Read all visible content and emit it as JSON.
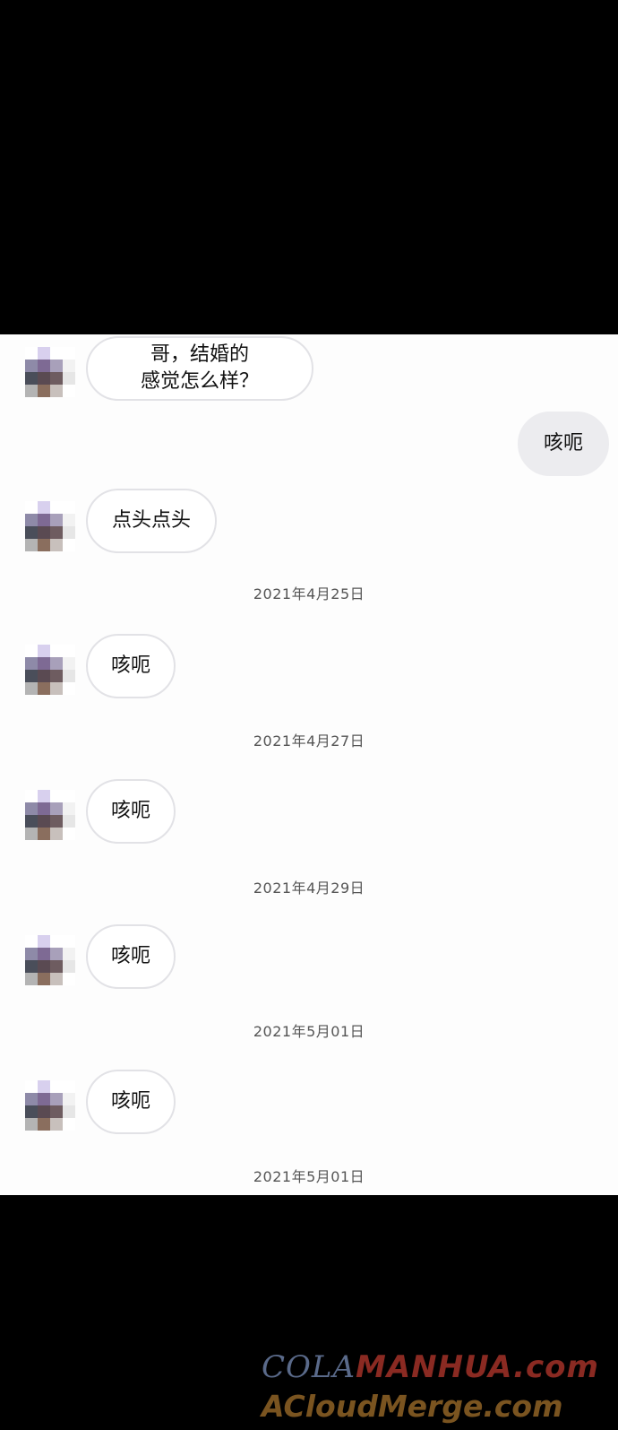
{
  "messages": [
    {
      "from": "contact",
      "text": "哥，结婚的\n感觉怎么样？"
    },
    {
      "from": "me",
      "text": "咳呃"
    },
    {
      "from": "contact",
      "text": "点头点头"
    },
    {
      "from": "contact",
      "text": "咳呃"
    },
    {
      "from": "contact",
      "text": "咳呃"
    },
    {
      "from": "contact",
      "text": "咳呃"
    },
    {
      "from": "contact",
      "text": "咳呃"
    }
  ],
  "dates": [
    "2021年4月25日",
    "2021年4月27日",
    "2021年4月29日",
    "2021年5月01日",
    "2021年5月01日"
  ],
  "avatar_colors": [
    "#ffffff",
    "#d8d0ee",
    "#ffffff",
    "#ffffff",
    "#8e8aa8",
    "#7e6a94",
    "#a8a0ba",
    "#f2f2f2",
    "#4a4e5a",
    "#5a4a52",
    "#6e5c60",
    "#e6e6e6",
    "#b4b4b4",
    "#8a6e5e",
    "#c8c0bc",
    "#ffffff"
  ],
  "watermark": {
    "line1_part1": "COLA",
    "line1_part2": "MANHUA.com",
    "line2": "ACloudMerge.com"
  }
}
